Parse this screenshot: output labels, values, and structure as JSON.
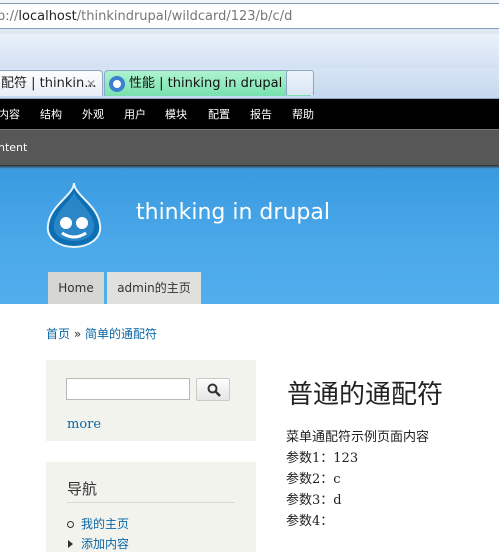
{
  "browser": {
    "url_prefix": "p://",
    "url_host": "localhost",
    "url_path": "/thinkindrupal/wildcard/123/b/c/d",
    "tabs": [
      {
        "label": "配符 | thinkin...",
        "close": "✕"
      },
      {
        "label": "性能 | thinking in drupal"
      }
    ]
  },
  "toolbar": {
    "items": [
      "内容",
      "结构",
      "外观",
      "用户",
      "模块",
      "配置",
      "报告",
      "帮助"
    ],
    "shortcut": "ntent"
  },
  "header": {
    "site_name": "thinking in drupal",
    "menu": [
      "Home",
      "admin的主页"
    ]
  },
  "breadcrumb": {
    "home": "首页",
    "sep": "»",
    "current": "简单的通配符"
  },
  "sidebar": {
    "search": {
      "value": "",
      "more": "more"
    },
    "nav": {
      "title": "导航",
      "items": [
        "我的主页",
        "添加内容"
      ]
    }
  },
  "main": {
    "title": "普通的通配符",
    "lines": [
      "菜单通配符示例页面内容",
      "参数1：123",
      "参数2：c",
      "参数3：d",
      "参数4："
    ]
  }
}
